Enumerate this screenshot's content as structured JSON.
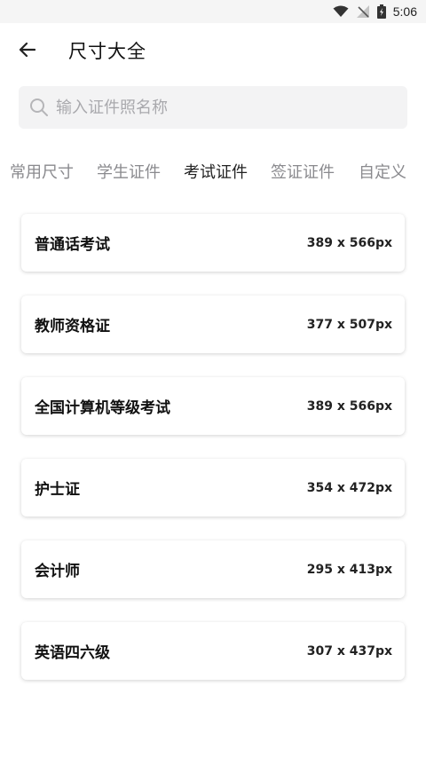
{
  "status_bar": {
    "time": "5:06"
  },
  "header": {
    "title": "尺寸大全"
  },
  "search": {
    "placeholder": "输入证件照名称"
  },
  "tabs": [
    {
      "label": "常用尺寸"
    },
    {
      "label": "学生证件"
    },
    {
      "label": "考试证件",
      "active": true
    },
    {
      "label": "签证证件"
    },
    {
      "label": "自定义"
    }
  ],
  "items": [
    {
      "name": "普通话考试",
      "size": "389 x 566px"
    },
    {
      "name": "教师资格证",
      "size": "377 x 507px"
    },
    {
      "name": "全国计算机等级考试",
      "size": "389 x 566px"
    },
    {
      "name": "护士证",
      "size": "354 x 472px"
    },
    {
      "name": "会计师",
      "size": "295 x 413px"
    },
    {
      "name": "英语四六级",
      "size": "307 x 437px"
    }
  ]
}
